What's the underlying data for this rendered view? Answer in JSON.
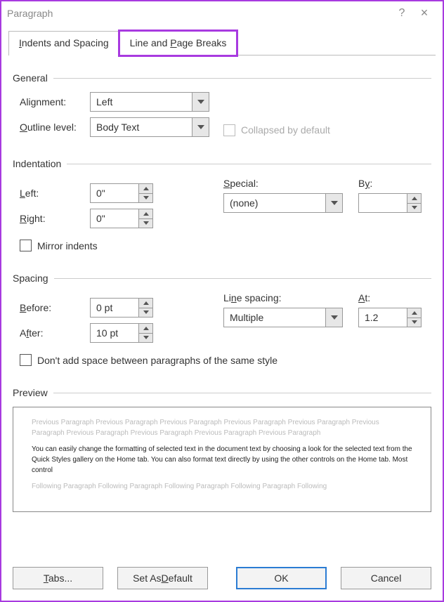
{
  "title": "Paragraph",
  "tabs": {
    "indents": "Indents and Spacing",
    "lpb": "Line and Page Breaks"
  },
  "general": {
    "heading": "General",
    "alignment_label": "Alignment:",
    "alignment_value": "Left",
    "outline_label": "Outline level:",
    "outline_value": "Body Text",
    "collapsed_label": "Collapsed by default"
  },
  "indent": {
    "heading": "Indentation",
    "left_label": "Left:",
    "left_value": "0\"",
    "right_label": "Right:",
    "right_value": "0\"",
    "special_label": "Special:",
    "special_value": "(none)",
    "by_label": "By:",
    "by_value": "",
    "mirror_label": "Mirror indents"
  },
  "spacing": {
    "heading": "Spacing",
    "before_label": "Before:",
    "before_value": "0 pt",
    "after_label": "After:",
    "after_value": "10 pt",
    "ls_label": "Line spacing:",
    "ls_value": "Multiple",
    "at_label": "At:",
    "at_value": "1.2",
    "dontadd_label": "Don't add space between paragraphs of the same style"
  },
  "preview": {
    "heading": "Preview",
    "prev_text": "Previous Paragraph Previous Paragraph Previous Paragraph Previous Paragraph Previous Paragraph Previous Paragraph Previous Paragraph Previous Paragraph Previous Paragraph Previous Paragraph",
    "body_text": "You can easily change the formatting of selected text in the document text by choosing a look for the selected text from the Quick Styles gallery on the Home tab. You can also format text directly by using the other controls on the Home tab. Most control",
    "foll_text": "Following Paragraph Following Paragraph Following Paragraph Following Paragraph Following"
  },
  "footer": {
    "tabs": "Tabs...",
    "setdefault": "Set As Default",
    "ok": "OK",
    "cancel": "Cancel"
  }
}
